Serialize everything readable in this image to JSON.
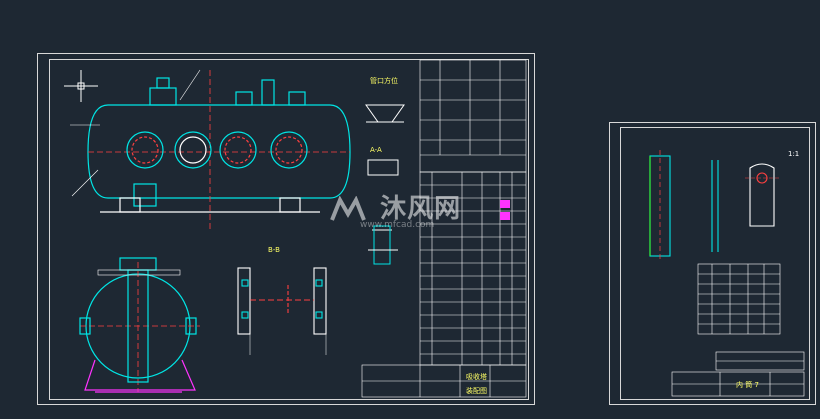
{
  "viewport": {
    "background": "#1e2833"
  },
  "colors": {
    "frame": "#d8d8d8",
    "cyan": "#00e5e5",
    "yellow": "#ffff66",
    "red": "#ff4040",
    "white": "#ffffff",
    "magenta": "#ff33ff",
    "green": "#33ff33"
  },
  "sheets": {
    "main_title_block": {
      "text_1": "吸收塔",
      "text_2": "装配图"
    },
    "detail_title_block": {
      "text_1": "内 筒 7"
    }
  },
  "watermark": {
    "text": "沐风网",
    "url": "www.mfcad.com"
  },
  "labels": {
    "detail_a": "管口方位",
    "detail_b": "A-A",
    "section": "B-B",
    "scale": "1:1"
  }
}
